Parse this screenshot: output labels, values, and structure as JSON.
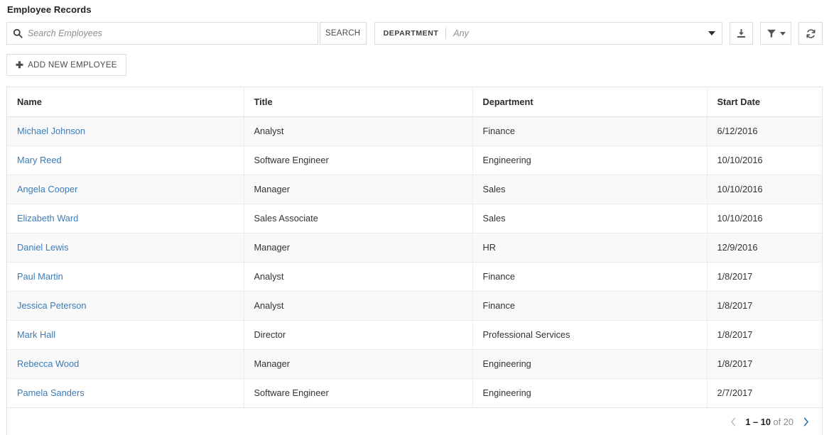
{
  "page": {
    "title": "Employee Records"
  },
  "toolbar": {
    "search": {
      "icon": "search-icon",
      "value": "",
      "placeholder": "Search Employees",
      "button_label": "SEARCH"
    },
    "department_filter": {
      "label": "DEPARTMENT",
      "value": "",
      "placeholder": "Any",
      "caret_icon": "chevron-down-icon"
    },
    "actions": [
      {
        "name": "download-button",
        "icon": "download-icon"
      },
      {
        "name": "filter-button",
        "icon": "funnel-icon",
        "caret_icon": "chevron-down-icon"
      },
      {
        "name": "refresh-button",
        "icon": "refresh-icon"
      }
    ],
    "add_button": {
      "icon": "plus-icon",
      "label": "ADD NEW EMPLOYEE"
    }
  },
  "table": {
    "columns": [
      "Name",
      "Title",
      "Department",
      "Start Date"
    ],
    "rows": [
      {
        "name": "Michael Johnson",
        "title": "Analyst",
        "department": "Finance",
        "start_date": "6/12/2016"
      },
      {
        "name": "Mary Reed",
        "title": "Software Engineer",
        "department": "Engineering",
        "start_date": "10/10/2016"
      },
      {
        "name": "Angela Cooper",
        "title": "Manager",
        "department": "Sales",
        "start_date": "10/10/2016"
      },
      {
        "name": "Elizabeth Ward",
        "title": "Sales Associate",
        "department": "Sales",
        "start_date": "10/10/2016"
      },
      {
        "name": "Daniel Lewis",
        "title": "Manager",
        "department": "HR",
        "start_date": "12/9/2016"
      },
      {
        "name": "Paul Martin",
        "title": "Analyst",
        "department": "Finance",
        "start_date": "1/8/2017"
      },
      {
        "name": "Jessica Peterson",
        "title": "Analyst",
        "department": "Finance",
        "start_date": "1/8/2017"
      },
      {
        "name": "Mark Hall",
        "title": "Director",
        "department": "Professional Services",
        "start_date": "1/8/2017"
      },
      {
        "name": "Rebecca Wood",
        "title": "Manager",
        "department": "Engineering",
        "start_date": "1/8/2017"
      },
      {
        "name": "Pamela Sanders",
        "title": "Software Engineer",
        "department": "Engineering",
        "start_date": "2/7/2017"
      }
    ]
  },
  "pagination": {
    "prev_icon": "chevron-left-icon",
    "next_icon": "chevron-right-icon",
    "range": "1 – 10",
    "total_text": " of 20"
  },
  "colors": {
    "link": "#3b7cb8",
    "next_chevron": "#2f6fa8",
    "prev_chevron": "#b9b9b9",
    "border": "#dcdcdc",
    "row_stripe": "#f9f9f9"
  }
}
